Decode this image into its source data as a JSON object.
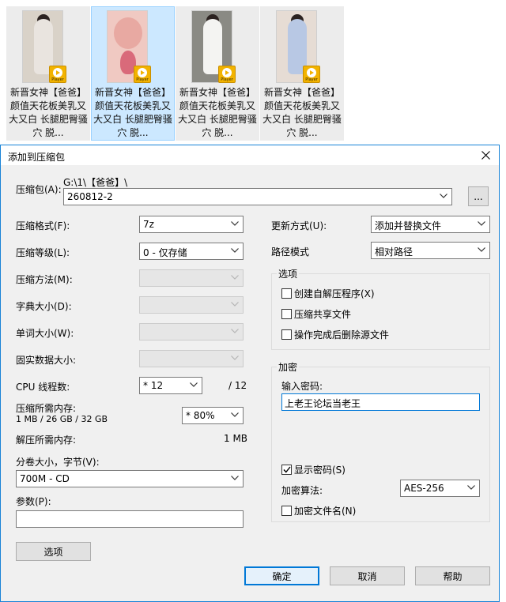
{
  "explorer": {
    "items": [
      {
        "caption": "新晋女神【爸爸】颜值天花板美乳又大又白 长腿肥臀骚穴 脱...",
        "selected": false,
        "badge": "Player"
      },
      {
        "caption": "新晋女神【爸爸】颜值天花板美乳又大又白 长腿肥臀骚穴 脱...",
        "selected": true,
        "badge": "Player"
      },
      {
        "caption": "新晋女神【爸爸】颜值天花板美乳又大又白 长腿肥臀骚穴 脱...",
        "selected": false,
        "badge": "Player"
      },
      {
        "caption": "新晋女神【爸爸】颜值天花板美乳又大又白 长腿肥臀骚穴 脱...",
        "selected": false,
        "badge": "Player"
      }
    ]
  },
  "dialog": {
    "title": "添加到压缩包",
    "archive_label": "压缩包(A):",
    "archive_path": "G:\\1\\【爸爸】\\",
    "archive_name": "260812-2",
    "browse_label": "...",
    "format_label": "压缩格式(F):",
    "format_value": "7z",
    "level_label": "压缩等级(L):",
    "level_value": "0 - 仅存储",
    "method_label": "压缩方法(M):",
    "dict_label": "字典大小(D):",
    "word_label": "单词大小(W):",
    "solid_label": "固实数据大小:",
    "threads_label": "CPU 线程数:",
    "threads_value": "* 12",
    "threads_max": "/ 12",
    "mem_label": "压缩所需内存:",
    "mem_detail": "1 MB / 26 GB / 32 GB",
    "mem_percent": "* 80%",
    "decomp_label": "解压所需内存:",
    "decomp_value": "1 MB",
    "volume_label": "分卷大小，字节(V):",
    "volume_value": "700M - CD",
    "params_label": "参数(P):",
    "params_value": "",
    "options_button": "选项",
    "update_label": "更新方式(U):",
    "update_value": "添加并替换文件",
    "path_label": "路径模式",
    "path_value": "相对路径",
    "options_group": "选项",
    "opt_sfx": "创建自解压程序(X)",
    "opt_shared": "压缩共享文件",
    "opt_delete": "操作完成后删除源文件",
    "enc_group": "加密",
    "pw_label": "输入密码:",
    "pw_value": "上老王论坛当老王",
    "show_pw": "显示密码(S)",
    "enc_method_label": "加密算法:",
    "enc_method_value": "AES-256",
    "enc_names": "加密文件名(N)",
    "ok": "确定",
    "cancel": "取消",
    "help": "帮助",
    "checks": {
      "sfx": false,
      "shared": false,
      "delete": false,
      "show_pw": true,
      "enc_names": false
    }
  }
}
